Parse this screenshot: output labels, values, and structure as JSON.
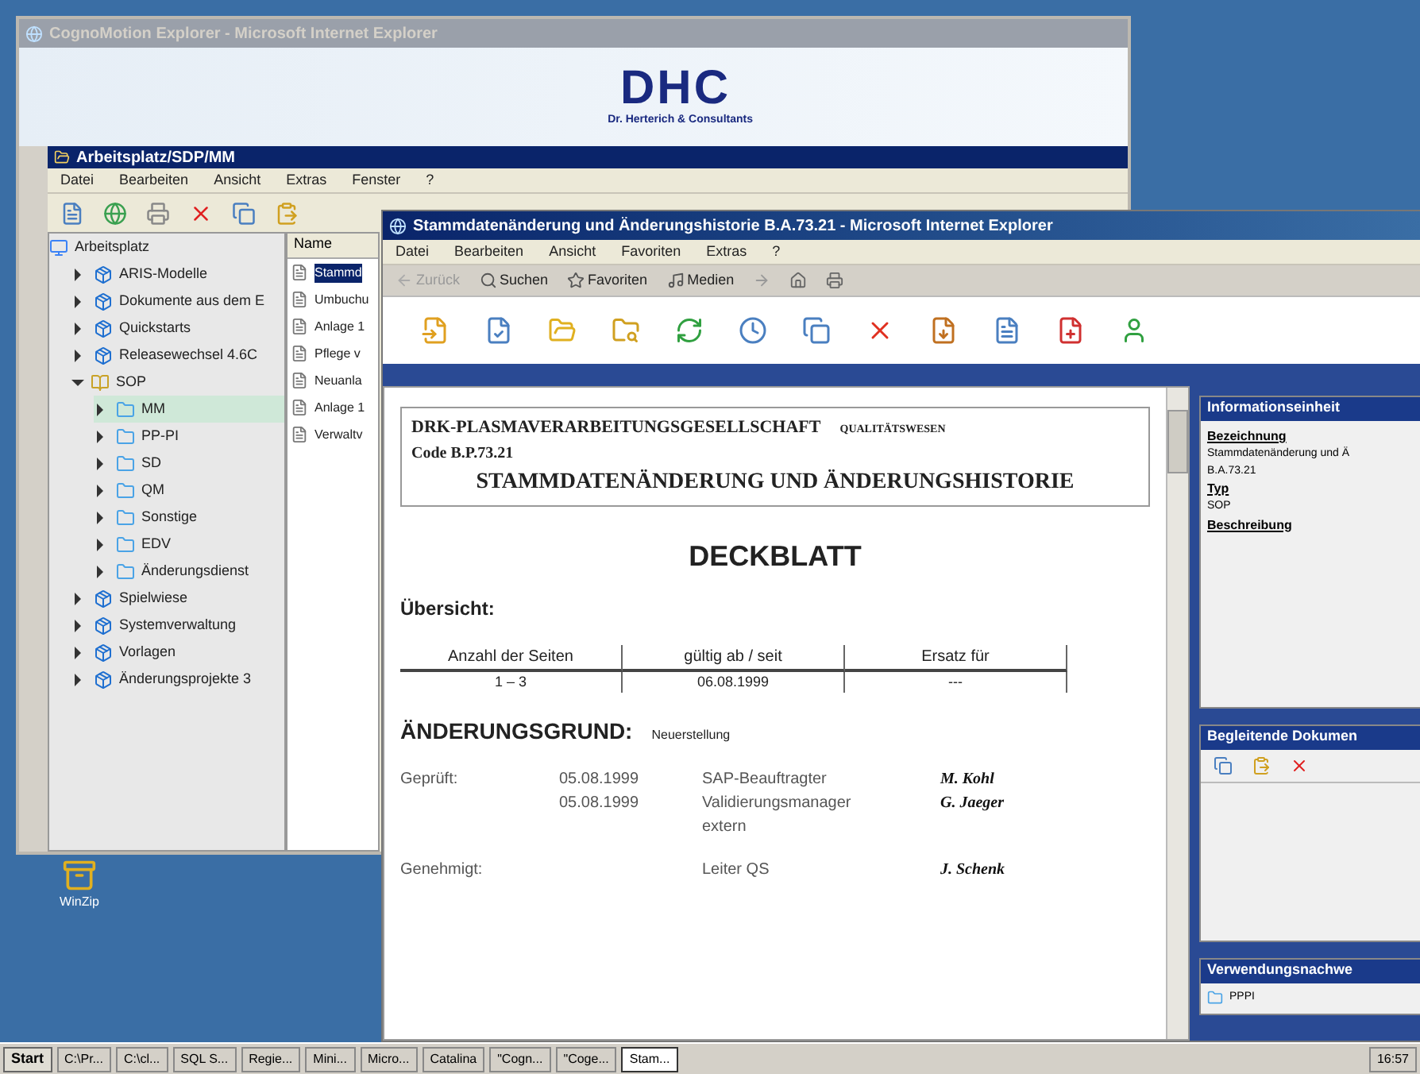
{
  "desktop": {
    "icons": [
      {
        "label": "WinZip"
      }
    ]
  },
  "back_window": {
    "title": "CognoMotion Explorer - Microsoft Internet Explorer",
    "active": false,
    "banner": {
      "logo": "DHC",
      "subtitle": "Dr. Herterich & Consultants"
    },
    "explorer": {
      "title": "Arbeitsplatz/SDP/MM",
      "menu": [
        "Datei",
        "Bearbeiten",
        "Ansicht",
        "Extras",
        "Fenster",
        "?"
      ],
      "tree": [
        {
          "label": "Arbeitsplatz",
          "kind": "root",
          "selected": false,
          "children": [
            {
              "label": "ARIS-Modelle",
              "kind": "package",
              "expanded": false,
              "selected": false
            },
            {
              "label": "Dokumente aus dem E",
              "kind": "package",
              "expanded": false,
              "selected": false
            },
            {
              "label": "Quickstarts",
              "kind": "package",
              "expanded": false,
              "selected": false
            },
            {
              "label": "Releasewechsel 4.6C",
              "kind": "package",
              "expanded": false,
              "selected": false
            },
            {
              "label": "SOP",
              "kind": "book",
              "expanded": true,
              "selected": false,
              "children": [
                {
                  "label": "MM",
                  "kind": "folder",
                  "expanded": false,
                  "selected": true
                },
                {
                  "label": "PP-PI",
                  "kind": "folder",
                  "expanded": false,
                  "selected": false
                },
                {
                  "label": "SD",
                  "kind": "folder",
                  "expanded": false,
                  "selected": false
                },
                {
                  "label": "QM",
                  "kind": "folder",
                  "expanded": false,
                  "selected": false
                },
                {
                  "label": "Sonstige",
                  "kind": "folder",
                  "expanded": false,
                  "selected": false
                },
                {
                  "label": "EDV",
                  "kind": "folder",
                  "expanded": false,
                  "selected": false
                },
                {
                  "label": "Änderungsdienst",
                  "kind": "folder",
                  "expanded": false,
                  "selected": false
                }
              ]
            },
            {
              "label": "Spielwiese",
              "kind": "package",
              "expanded": false,
              "selected": false
            },
            {
              "label": "Systemverwaltung",
              "kind": "package",
              "expanded": false,
              "selected": false
            },
            {
              "label": "Vorlagen",
              "kind": "package",
              "expanded": false,
              "selected": false
            },
            {
              "label": "Änderungsprojekte 3",
              "kind": "package",
              "expanded": false,
              "selected": false
            }
          ]
        }
      ],
      "list": {
        "column": "Name",
        "items": [
          {
            "label": "Stammd",
            "selected": true
          },
          {
            "label": "Umbuchu",
            "selected": false
          },
          {
            "label": "Anlage 1",
            "selected": false
          },
          {
            "label": "Pflege v",
            "selected": false
          },
          {
            "label": "Neuanla",
            "selected": false
          },
          {
            "label": "Anlage 1",
            "selected": false
          },
          {
            "label": "Verwaltv",
            "selected": false
          }
        ]
      }
    }
  },
  "front_window": {
    "title": "Stammdatenänderung und Änderungshistorie B.A.73.21 - Microsoft Internet Explorer",
    "active": true,
    "menu": [
      "Datei",
      "Bearbeiten",
      "Ansicht",
      "Favoriten",
      "Extras",
      "?"
    ],
    "nav_toolbar": [
      {
        "label": "Zurück",
        "kind": "back",
        "disabled": true
      },
      {
        "label": "Suchen",
        "kind": "search",
        "disabled": false
      },
      {
        "label": "Favoriten",
        "kind": "favorites",
        "disabled": false
      },
      {
        "label": "Medien",
        "kind": "media",
        "disabled": false
      }
    ],
    "document": {
      "company": "DRK-PLASMAVERARBEITUNGSGESELLSCHAFT",
      "department": "QUALITÄTSWESEN",
      "code": "Code B.P.73.21",
      "doc_title": "STAMMDATENÄNDERUNG UND ÄNDERUNGSHISTORIE",
      "heading": "DECKBLATT",
      "overview_label": "Übersicht:",
      "table": {
        "columns": [
          "Anzahl der Seiten",
          "gültig ab / seit",
          "Ersatz für"
        ],
        "row": [
          "1 – 3",
          "06.08.1999",
          "---"
        ]
      },
      "reason_label": "ÄNDERUNGSGRUND:",
      "reason": "Neuerstellung",
      "signoffs": [
        {
          "label": "Geprüft:",
          "dates": [
            "05.08.1999",
            "05.08.1999"
          ],
          "roles": [
            "SAP-Beauftragter",
            "Validierungsmanager extern"
          ],
          "signatures": [
            "M. Kohl",
            "G. Jaeger"
          ]
        },
        {
          "label": "Genehmigt:",
          "roles": [
            "Leiter QS"
          ],
          "signatures": [
            "J. Schenk"
          ]
        }
      ]
    },
    "side_panels": [
      {
        "title": "Informationseinheit",
        "kind": "info",
        "fields": [
          {
            "label": "Bezeichnung",
            "values": [
              "Stammdatenänderung und Ä",
              "B.A.73.21"
            ]
          },
          {
            "label": "Typ",
            "values": [
              "SOP"
            ]
          },
          {
            "label": "Beschreibung"
          }
        ]
      },
      {
        "title": "Begleitende Dokumen",
        "kind": "documents"
      },
      {
        "title": "Verwendungsnachwe",
        "kind": "usage",
        "items": [
          "PPPI"
        ]
      }
    ]
  },
  "taskbar": {
    "start": "Start",
    "tasks": [
      {
        "label": "C:\\Pr...",
        "selected": false
      },
      {
        "label": "C:\\cl...",
        "selected": false
      },
      {
        "label": "SQL S...",
        "selected": false
      },
      {
        "label": "Regie...",
        "selected": false
      },
      {
        "label": "Mini...",
        "selected": false
      },
      {
        "label": "Micro...",
        "selected": false
      },
      {
        "label": "Catalina",
        "selected": false
      },
      {
        "label": "\"Cogn...",
        "selected": false
      },
      {
        "label": "\"Coge...",
        "selected": false
      },
      {
        "label": "Stam...",
        "selected": true
      }
    ],
    "clock": "16:57"
  }
}
